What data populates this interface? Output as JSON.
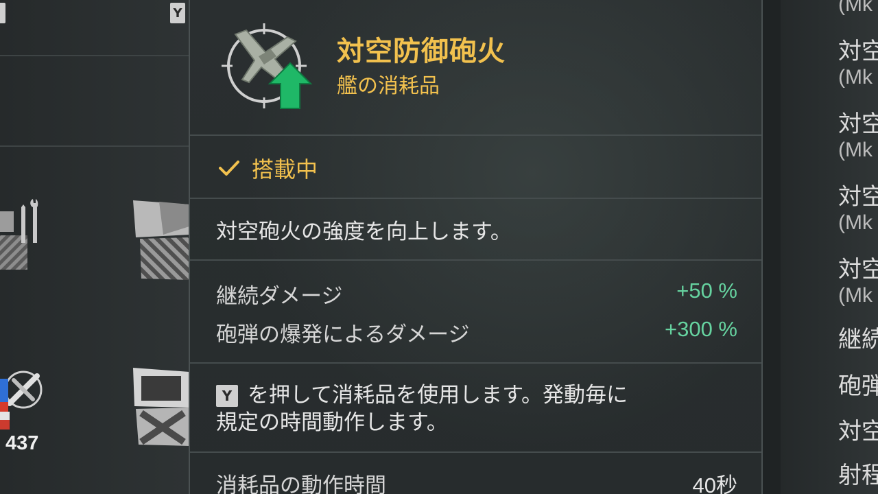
{
  "left_panel": {
    "key_tag": "Y",
    "count": "437"
  },
  "tooltip": {
    "title": "対空防御砲火",
    "subtitle": "艦の消耗品",
    "status": "搭載中",
    "description": "対空砲火の強度を向上します。",
    "stats": [
      {
        "label": "継続ダメージ",
        "value": "+50 %"
      },
      {
        "label": "砲弾の爆発によるダメージ",
        "value": "+300 %"
      }
    ],
    "hint_key": "Y",
    "hint_line1": "を押して消耗品を使用します。発動毎に",
    "hint_line2": "規定の時間動作します。",
    "duration_label": "消耗品の動作時間",
    "duration_value": "40秒",
    "icon": "aa-plane-upgrade-icon",
    "colors": {
      "title": "#f2c14e",
      "positive_value": "#66d3a0",
      "upgrade_arrow": "#1fb867"
    }
  },
  "right_panel": {
    "items": [
      {
        "title": "",
        "sub": "(Mk"
      },
      {
        "title": "対空",
        "sub": "(Mk"
      },
      {
        "title": "対空",
        "sub": "(Mk"
      },
      {
        "title": "対空",
        "sub": "(Mk"
      },
      {
        "title": "対空",
        "sub": "(Mk"
      }
    ],
    "tail_items": [
      "継続",
      "砲弾",
      "対空",
      "射程"
    ]
  }
}
